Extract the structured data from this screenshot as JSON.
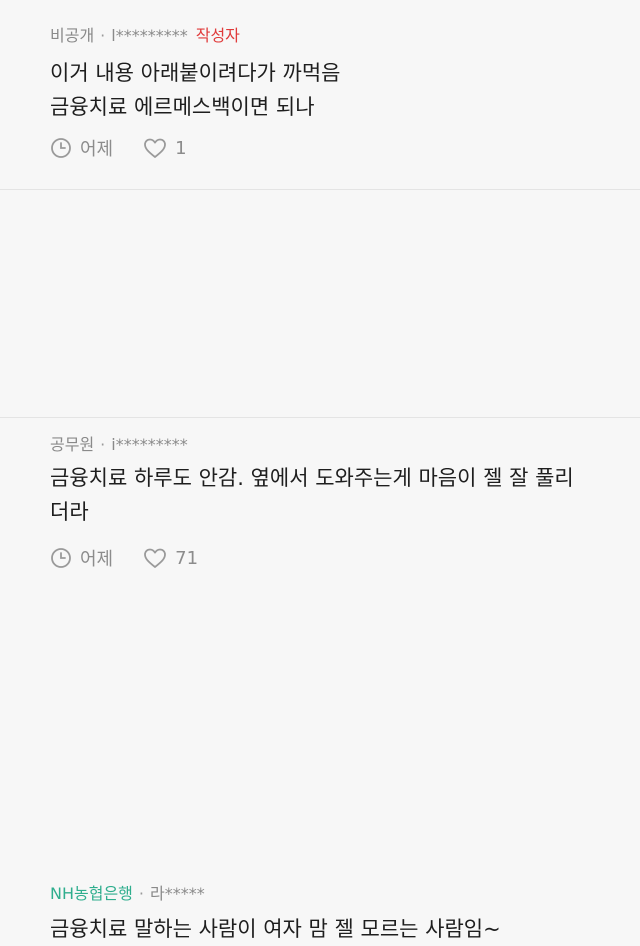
{
  "comments": [
    {
      "nickname": "비공개",
      "separator": "·",
      "user_id": "l*********",
      "author_tag": "작성자",
      "body": "이거 내용 아래붙이려다가 까먹음\n금융치료 에르메스백이면 되나",
      "time_label": "어제",
      "likes": "1",
      "icons": {
        "time": "clock-icon",
        "like": "heart-icon"
      }
    },
    {
      "nickname": "공무원",
      "separator": "·",
      "user_id": "i*********",
      "body": "금융치료 하루도 안감. 옆에서 도와주는게 마음이 젤 잘 풀리\n더라",
      "time_label": "어제",
      "likes": "71",
      "icons": {
        "time": "clock-icon",
        "like": "heart-icon"
      }
    },
    {
      "nickname": "NH농협은행",
      "separator": "·",
      "user_id": "라*****",
      "body": "금융치료 말하는 사람이 여자 맘 젤 모르는 사람임~"
    }
  ],
  "colors": {
    "background": "#f7f7f7",
    "author_tag": "#e03b3b",
    "bank_nickname": "#2fae8e",
    "meta_text": "#8a8a8a"
  }
}
